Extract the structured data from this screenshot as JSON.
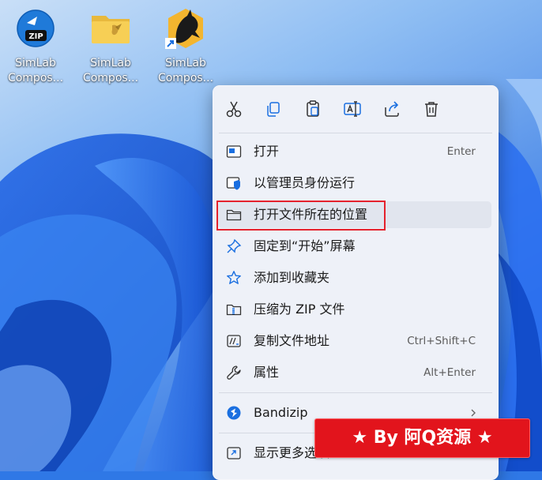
{
  "desktop": {
    "icons": [
      {
        "line1": "SimLab",
        "line2": "Compos...",
        "icon": "zip-archive-icon"
      },
      {
        "line1": "SimLab",
        "line2": "Compos...",
        "icon": "folder-icon"
      },
      {
        "line1": "SimLab",
        "line2": "Compos...",
        "icon": "dragon-app-shortcut-icon"
      }
    ]
  },
  "context_menu": {
    "toolbar": [
      {
        "icon": "cut-icon"
      },
      {
        "icon": "copy-icon"
      },
      {
        "icon": "paste-icon"
      },
      {
        "icon": "rename-icon"
      },
      {
        "icon": "share-icon"
      },
      {
        "icon": "delete-icon"
      }
    ],
    "items": [
      {
        "label": "打开",
        "shortcut": "Enter",
        "icon": "open-window-icon"
      },
      {
        "label": "以管理员身份运行",
        "shortcut": "",
        "icon": "admin-shield-icon"
      },
      {
        "label": "打开文件所在的位置",
        "shortcut": "",
        "icon": "folder-outline-icon"
      },
      {
        "label": "固定到“开始”屏幕",
        "shortcut": "",
        "icon": "pin-icon"
      },
      {
        "label": "添加到收藏夹",
        "shortcut": "",
        "icon": "star-icon"
      },
      {
        "label": "压缩为 ZIP 文件",
        "shortcut": "",
        "icon": "zip-compress-icon"
      },
      {
        "label": "复制文件地址",
        "shortcut": "Ctrl+Shift+C",
        "icon": "copy-path-icon"
      },
      {
        "label": "属性",
        "shortcut": "Alt+Enter",
        "icon": "wrench-icon"
      },
      {
        "label": "Bandizip",
        "shortcut": "",
        "icon": "bandizip-icon"
      },
      {
        "label": "显示更多选项",
        "shortcut": "",
        "icon": "more-options-icon"
      }
    ]
  },
  "watermark": {
    "text": "★ By 阿Q资源 ★"
  },
  "colors": {
    "menu_bg": "#eef1f8",
    "highlight_border": "#e5222d",
    "watermark_bg": "#e2141c",
    "accent": "#1a6fe0"
  }
}
